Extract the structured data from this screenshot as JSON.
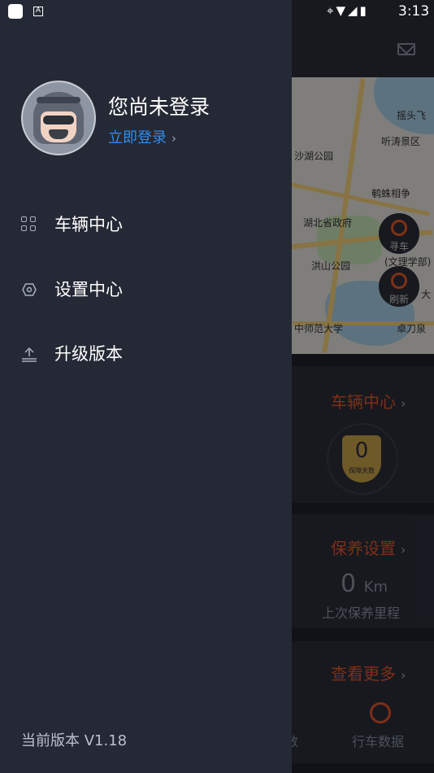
{
  "status_bar": {
    "time": "3:13",
    "icons": [
      "location-icon",
      "wifi-icon",
      "signal-icon",
      "battery-icon"
    ]
  },
  "background": {
    "map_labels": [
      "摇头飞",
      "听涛景区",
      "沙湖公园",
      "鹌蛛相争",
      "湖北省政府",
      "寻车",
      "(文理学部)",
      "洪山公园",
      "刷新",
      "大",
      "中师范大学",
      "卓刀泉"
    ],
    "vehicle_card": {
      "title": "车辆中心",
      "shield_value": "0",
      "shield_label": "保障天数"
    },
    "maintenance_card": {
      "title": "保养设置",
      "km_value": "0",
      "km_unit": "Km",
      "km_label": "上次保养里程"
    },
    "more_card": {
      "title": "查看更多",
      "left_label": "数",
      "right_label": "行车数据"
    }
  },
  "drawer": {
    "login_title": "您尚未登录",
    "login_link": "立即登录",
    "menu": [
      {
        "label": "车辆中心",
        "icon": "grid-icon"
      },
      {
        "label": "设置中心",
        "icon": "settings-hex-icon"
      },
      {
        "label": "升级版本",
        "icon": "upload-icon"
      }
    ],
    "version": "当前版本 V1.18"
  },
  "colors": {
    "drawer_bg": "#242935",
    "link": "#2f8cf0",
    "accent": "#e8542a"
  }
}
